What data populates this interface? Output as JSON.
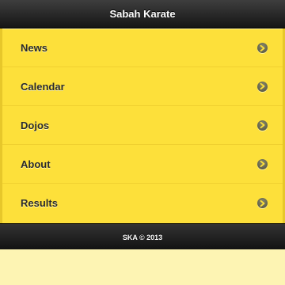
{
  "header": {
    "title": "Sabah Karate"
  },
  "menu": {
    "items": [
      {
        "label": "News",
        "icon": "chevron-right-icon"
      },
      {
        "label": "Calendar",
        "icon": "chevron-right-icon"
      },
      {
        "label": "Dojos",
        "icon": "chevron-right-icon"
      },
      {
        "label": "About",
        "icon": "chevron-right-icon"
      },
      {
        "label": "Results",
        "icon": "chevron-right-icon"
      }
    ]
  },
  "footer": {
    "text": "SKA © 2013"
  },
  "colors": {
    "header_bg": "#222222",
    "menu_bg": "#fde03a",
    "page_bg": "#fdf4b3",
    "arrow_icon": "#5a5a48"
  }
}
